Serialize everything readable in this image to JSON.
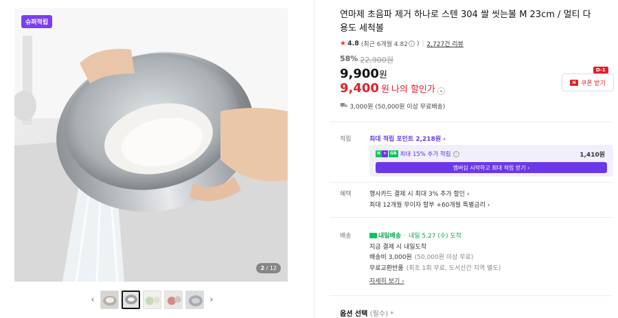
{
  "gallery": {
    "badge": "슈퍼적립",
    "counter_current": "2",
    "counter_total": "/ 12",
    "prev_arrow": "‹",
    "next_arrow": "›",
    "thumbnail_count": 5,
    "active_thumbnail": 2
  },
  "product": {
    "title": "연마제 초음파 제거 하나로 스텐 304 쌀 씻는볼 M 23cm / 멀티 다용도 세척볼",
    "rating": "4.8",
    "rating_recent": "(최근 6개월 4.82",
    "rating_recent_close": ")",
    "review_count": "2,727건 리뷰",
    "discount_rate": "58%",
    "original_price": "22,900원",
    "price": "9,900",
    "price_unit": "원",
    "my_price": "9,400",
    "my_price_unit": "원",
    "my_price_label": "나의 할인가",
    "coupon_tag": "D-1",
    "coupon_button": "쿠폰 받기",
    "coupon_icon": "N",
    "shipping_summary": "3,000원 (50,000원 이상 무료배송)"
  },
  "points": {
    "label": "적립",
    "max_points": "최대 적립 포인트 2,218원 ›",
    "member_text": "최대 15% 추가 적립",
    "member_amount": "1,410원",
    "member_button": "멤버십 시작하고 최대 적립 받기 ›",
    "np_n": "N",
    "np_plus": "+",
    "np_g": "GR"
  },
  "benefits": {
    "label": "혜택",
    "line1": "행사카드 결제 시 최대 3% 추가 할인 ›",
    "line2": "최대 12개월 무이자 할부 +60개월 특별금리 ›"
  },
  "delivery": {
    "label": "배송",
    "badge": "내일배송",
    "arrival": "내일 5.27 (수) 도착",
    "line1": "지금 결제 시 내일도착",
    "fee": "배송비 3,000원",
    "fee_note": "(50,000원 이상 무료)",
    "returns": "무료교환반품",
    "returns_note": "(최초 1회 무료, 도서산간 지역 별도)",
    "more": "자세히 보기 ›"
  },
  "options": {
    "label": "옵션 선택",
    "required": "(필수) *"
  },
  "colors": {
    "accent_purple": "#6a38e8",
    "price_red": "#e0202a",
    "delivery_green": "#03a94d"
  }
}
